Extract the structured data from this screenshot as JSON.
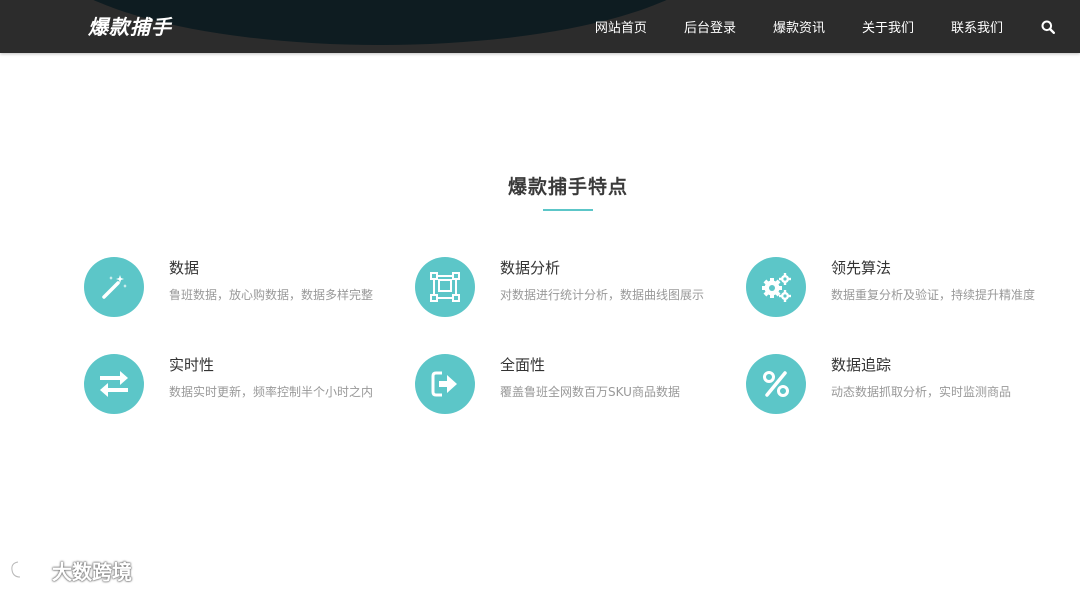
{
  "header": {
    "logo_text": "爆款捕手",
    "nav": [
      "网站首页",
      "后台登录",
      "爆款资讯",
      "关于我们",
      "联系我们"
    ],
    "search_icon": "search-icon"
  },
  "section": {
    "title": "爆款捕手特点"
  },
  "features": [
    {
      "icon": "magic-wand-icon",
      "title": "数据",
      "desc": "鲁班数据，放心购数据，数据多样完整"
    },
    {
      "icon": "frame-icon",
      "title": "数据分析",
      "desc": "对数据进行统计分析，数据曲线图展示"
    },
    {
      "icon": "gears-icon",
      "title": "领先算法",
      "desc": "数据重复分析及验证，持续提升精准度"
    },
    {
      "icon": "exchange-icon",
      "title": "实时性",
      "desc": "数据实时更新，频率控制半个小时之内"
    },
    {
      "icon": "sign-in-icon",
      "title": "全面性",
      "desc": "覆盖鲁班全网数百万SKU商品数据"
    },
    {
      "icon": "percent-icon",
      "title": "数据追踪",
      "desc": "动态数据抓取分析，实时监测商品"
    }
  ],
  "watermark": {
    "text": "大数跨境"
  },
  "colors": {
    "accent": "#5cc6c8",
    "header_bg": "#2c2c2c",
    "header_arc": "#0e1c21"
  }
}
